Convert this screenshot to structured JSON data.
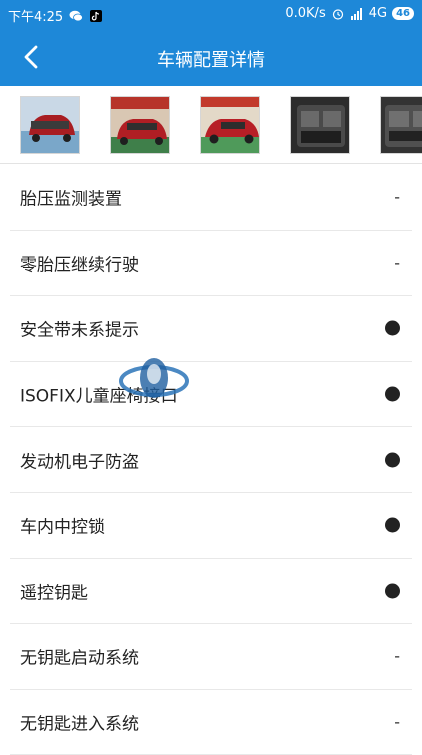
{
  "status_bar": {
    "time": "下午4:25",
    "speed": "0.0K/s",
    "network": "4G",
    "battery": "46"
  },
  "header": {
    "title": "车辆配置详情"
  },
  "thumbnails": [
    {
      "name": "car-photo-rear"
    },
    {
      "name": "car-photo-front"
    },
    {
      "name": "car-photo-side"
    },
    {
      "name": "car-photo-trunk"
    },
    {
      "name": "car-photo-trunk-2"
    }
  ],
  "specs": [
    {
      "label": "胎压监测装置",
      "value": "-",
      "kind": "dash"
    },
    {
      "label": "零胎压继续行驶",
      "value": "-",
      "kind": "dash"
    },
    {
      "label": "安全带未系提示",
      "value": "●",
      "kind": "dot"
    },
    {
      "label": "ISOFIX儿童座椅接口",
      "value": "●",
      "kind": "dot"
    },
    {
      "label": "发动机电子防盗",
      "value": "●",
      "kind": "dot"
    },
    {
      "label": "车内中控锁",
      "value": "●",
      "kind": "dot"
    },
    {
      "label": "遥控钥匙",
      "value": "●",
      "kind": "dot"
    },
    {
      "label": "无钥匙启动系统",
      "value": "-",
      "kind": "dash"
    },
    {
      "label": "无钥匙进入系统",
      "value": "-",
      "kind": "dash"
    }
  ],
  "colors": {
    "accent": "#1e88d8",
    "text": "#222222",
    "divider": "#e8e8e8"
  }
}
